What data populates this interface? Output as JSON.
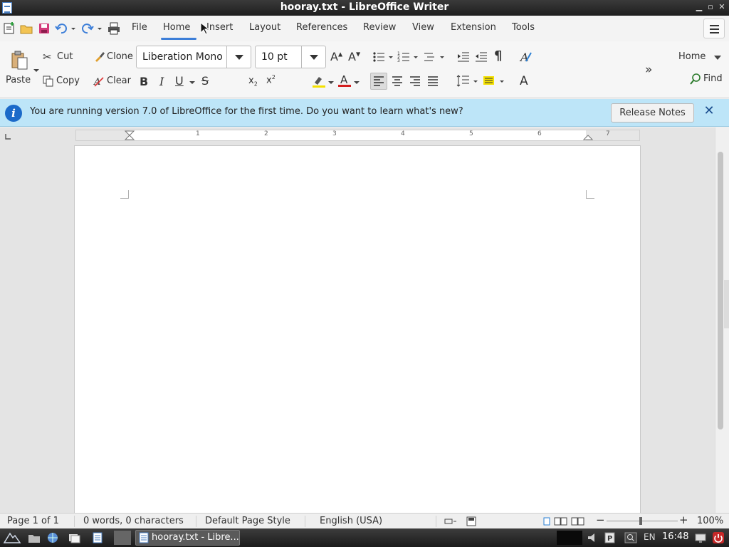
{
  "window": {
    "title": "hooray.txt - LibreOffice Writer"
  },
  "tabs": [
    "File",
    "Home",
    "Insert",
    "Layout",
    "References",
    "Review",
    "View",
    "Extension",
    "Tools"
  ],
  "ribbon": {
    "cut": "Cut",
    "copy": "Copy",
    "paste": "Paste",
    "clone": "Clone",
    "clear": "Clear",
    "font_name": "Liberation Mono",
    "font_size": "10 pt",
    "style_name": "Home",
    "find": "Find"
  },
  "infobar": {
    "message": "You are running version 7.0 of LibreOffice for the first time. Do you want to learn what's new?",
    "button": "Release Notes"
  },
  "ruler": {
    "numbers": [
      "1",
      "2",
      "3",
      "4",
      "5",
      "6",
      "7"
    ]
  },
  "status": {
    "page": "Page 1 of 1",
    "words": "0 words, 0 characters",
    "page_style": "Default Page Style",
    "language": "English (USA)",
    "zoom": "100%"
  },
  "taskbar": {
    "task_label": "hooray.txt - Libre...",
    "lang": "EN",
    "time": "16:48"
  },
  "colors": {
    "accent": "#3c7ed8",
    "infobar": "#bde5f8",
    "info_icon": "#1b6ac9"
  }
}
